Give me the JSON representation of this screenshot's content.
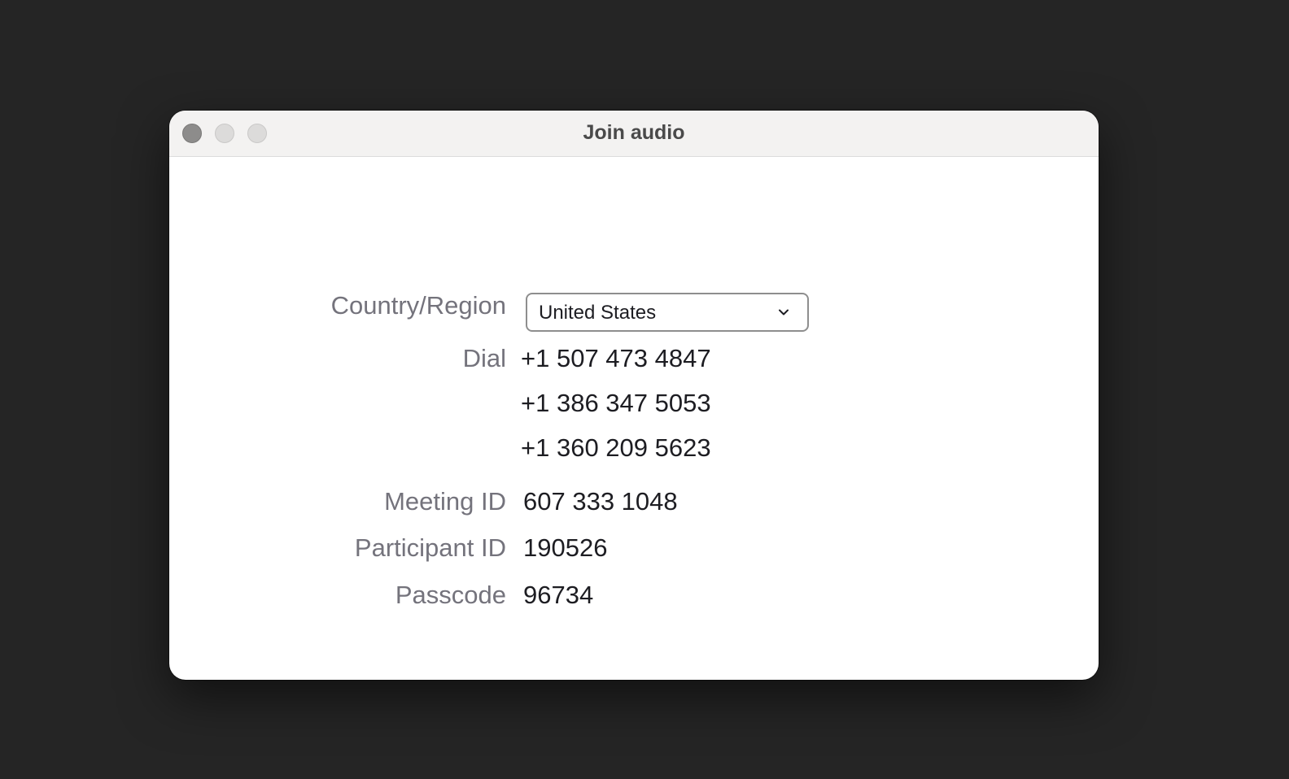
{
  "window": {
    "title": "Join audio"
  },
  "form": {
    "country_label": "Country/Region",
    "country_value": "United States",
    "dial_label": "Dial",
    "dial_numbers": [
      "+1 507 473 4847",
      "+1 386 347 5053",
      "+1 360 209 5623"
    ],
    "meeting_id_label": "Meeting ID",
    "meeting_id_value": "607 333 1048",
    "participant_id_label": "Participant ID",
    "participant_id_value": "190526",
    "passcode_label": "Passcode",
    "passcode_value": "96734"
  },
  "icons": {
    "close": "close-button",
    "minimize": "minimize-button",
    "maximize": "maximize-button",
    "dropdown": "chevron-down-icon"
  }
}
